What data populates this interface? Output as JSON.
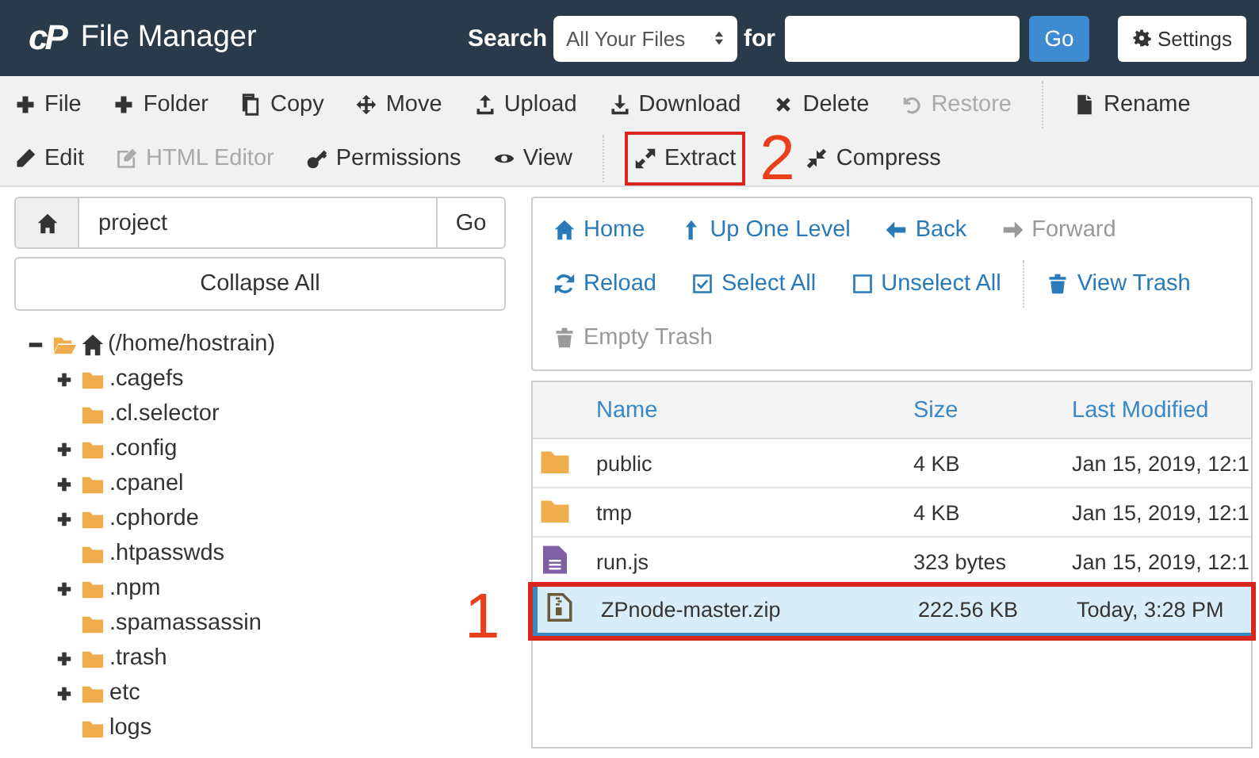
{
  "header": {
    "logo": "cP",
    "title": "File Manager",
    "search_label": "Search",
    "scope": "All Your Files",
    "for_label": "for",
    "go": "Go",
    "settings": "Settings"
  },
  "toolbar": [
    [
      {
        "label": "File",
        "disabled": false
      },
      {
        "label": "Folder",
        "disabled": false
      },
      {
        "label": "Copy",
        "disabled": false
      },
      {
        "label": "Move",
        "disabled": false
      },
      {
        "label": "Upload",
        "disabled": false
      },
      {
        "label": "Download",
        "disabled": false
      },
      {
        "label": "Delete",
        "disabled": false
      },
      {
        "label": "Restore",
        "disabled": true
      },
      {
        "label": "Rename",
        "disabled": false
      }
    ],
    [
      {
        "label": "Edit",
        "disabled": false
      },
      {
        "label": "HTML Editor",
        "disabled": true
      },
      {
        "label": "Permissions",
        "disabled": false
      },
      {
        "label": "View",
        "disabled": false
      },
      {
        "label": "Extract",
        "disabled": false,
        "callout": "2"
      },
      {
        "label": "Compress",
        "disabled": false
      }
    ]
  ],
  "sidebar": {
    "path": "project",
    "go": "Go",
    "collapse": "Collapse All",
    "tree": {
      "label": "(/home/hostrain)",
      "expanded": true,
      "children": [
        {
          "label": ".cagefs",
          "expanded": false,
          "has_children": true
        },
        {
          "label": ".cl.selector",
          "expanded": false,
          "has_children": false
        },
        {
          "label": ".config",
          "expanded": false,
          "has_children": true
        },
        {
          "label": ".cpanel",
          "expanded": false,
          "has_children": true
        },
        {
          "label": ".cphorde",
          "expanded": false,
          "has_children": true
        },
        {
          "label": ".htpasswds",
          "expanded": false,
          "has_children": false
        },
        {
          "label": ".npm",
          "expanded": false,
          "has_children": true
        },
        {
          "label": ".spamassassin",
          "expanded": false,
          "has_children": false
        },
        {
          "label": ".trash",
          "expanded": false,
          "has_children": true
        },
        {
          "label": "etc",
          "expanded": false,
          "has_children": true
        },
        {
          "label": "logs",
          "expanded": false,
          "has_children": false
        }
      ]
    }
  },
  "nav": [
    [
      {
        "label": "Home",
        "disabled": false
      },
      {
        "label": "Up One Level",
        "disabled": false
      },
      {
        "label": "Back",
        "disabled": false
      },
      {
        "label": "Forward",
        "disabled": true
      }
    ],
    [
      {
        "label": "Reload",
        "disabled": false
      },
      {
        "label": "Select All",
        "disabled": false
      },
      {
        "label": "Unselect All",
        "disabled": false
      },
      {
        "label": "View Trash",
        "disabled": false
      }
    ],
    [
      {
        "label": "Empty Trash",
        "disabled": true
      }
    ]
  ],
  "table": {
    "columns": [
      "Name",
      "Size",
      "Last Modified"
    ],
    "rows": [
      {
        "kind": "folder",
        "name": "public",
        "size": "4 KB",
        "modified": "Jan 15, 2019, 12:1",
        "selected": false
      },
      {
        "kind": "folder",
        "name": "tmp",
        "size": "4 KB",
        "modified": "Jan 15, 2019, 12:1",
        "selected": false
      },
      {
        "kind": "text",
        "name": "run.js",
        "size": "323 bytes",
        "modified": "Jan 15, 2019, 12:1",
        "selected": false
      },
      {
        "kind": "zip",
        "name": "ZPnode-master.zip",
        "size": "222.56 KB",
        "modified": "Today, 3:28 PM",
        "selected": true,
        "callout": "1"
      }
    ]
  }
}
